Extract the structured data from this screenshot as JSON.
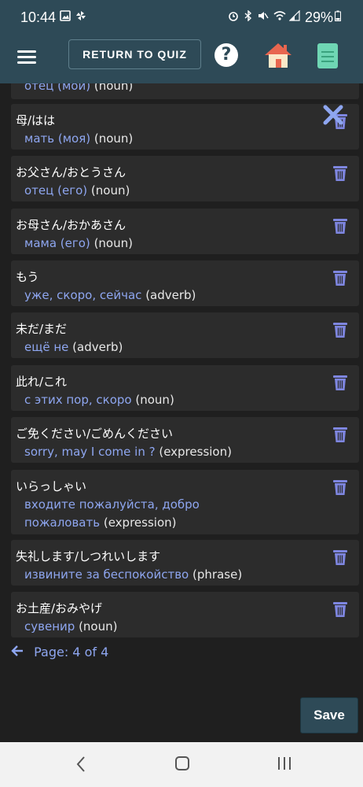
{
  "status": {
    "time": "10:44",
    "battery": "29%"
  },
  "header": {
    "return_label": "RETURN TO QUIZ",
    "help_label": "?"
  },
  "list": {
    "items": [
      {
        "jp": "",
        "ru": "отец (мой)",
        "pos": "(noun)"
      },
      {
        "jp": "母/はは",
        "ru": "мать (моя)",
        "pos": "(noun)"
      },
      {
        "jp": "お父さん/おとうさん",
        "ru": "отец (его)",
        "pos": "(noun)"
      },
      {
        "jp": "お母さん/おかあさん",
        "ru": "мама (его)",
        "pos": "(noun)"
      },
      {
        "jp": "もう",
        "ru": "уже, скоро, сейчас",
        "pos": "(adverb)"
      },
      {
        "jp": "未だ/まだ",
        "ru": "ещё не",
        "pos": "(adverb)"
      },
      {
        "jp": "此れ/これ",
        "ru": "с этих пор, скоро",
        "pos": "(noun)"
      },
      {
        "jp": "ご免ください/ごめんください",
        "ru": "sorry, may I come in ?",
        "pos": "(expression)"
      },
      {
        "jp": "いらっしゃい",
        "ru": "входите пожалуйста, добро пожаловать",
        "pos": "(expression)"
      },
      {
        "jp": "失礼します/しつれいします",
        "ru": "извините за беспокойство",
        "pos": "(phrase)"
      },
      {
        "jp": "お土産/おみやげ",
        "ru": "сувенир",
        "pos": "(noun)"
      }
    ]
  },
  "pager": {
    "label": "Page: 4 of 4"
  },
  "actions": {
    "save_label": "Save"
  },
  "colors": {
    "header_bg": "#2e4a57",
    "page_bg": "#1f1f1f",
    "card_bg": "#2c2c2c",
    "translation": "#8ea6f0",
    "trash": "#7e86e0"
  },
  "icons": {
    "menu": "hamburger-icon",
    "help": "question-circle-icon",
    "home": "home-icon",
    "book": "book-icon",
    "delete": "trash-icon",
    "close": "close-icon",
    "back": "arrow-left-icon"
  }
}
